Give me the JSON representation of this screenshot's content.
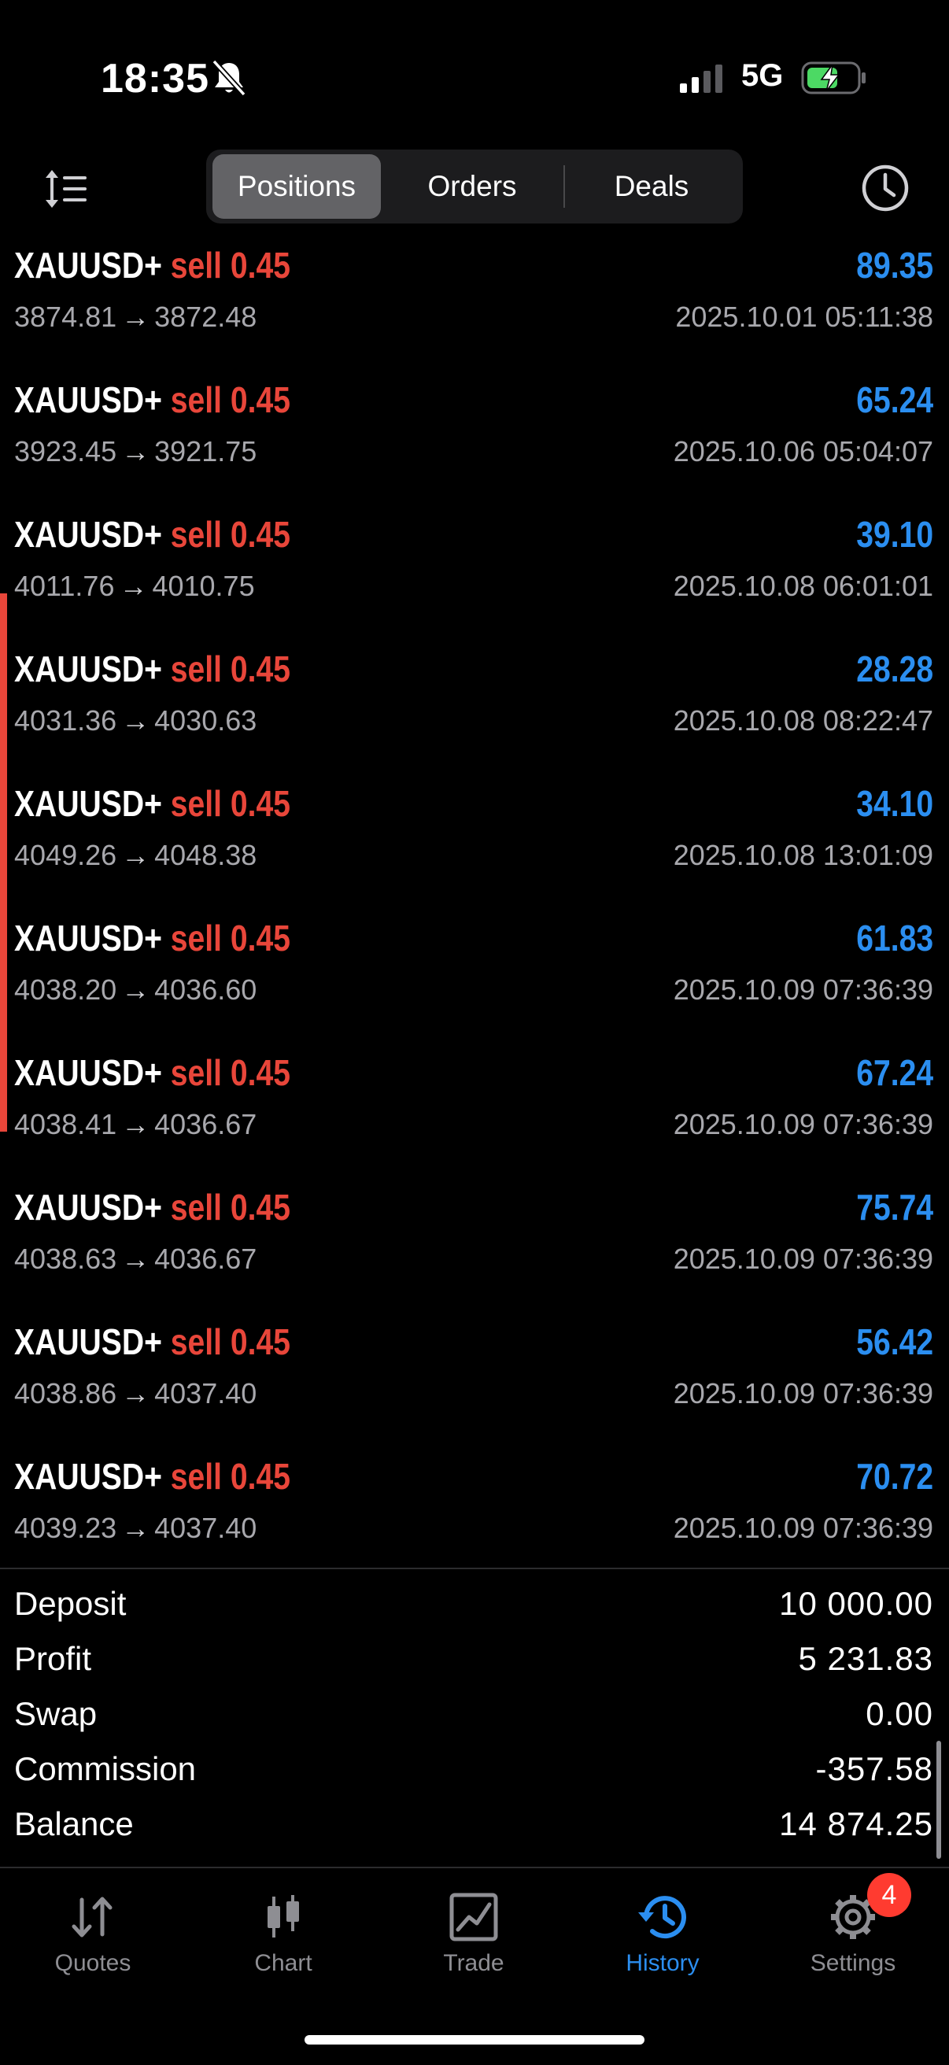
{
  "status": {
    "time": "18:35",
    "network": "5G"
  },
  "tabs": {
    "positions": "Positions",
    "orders": "Orders",
    "deals": "Deals"
  },
  "deals": [
    {
      "symbol": "XAUUSD+",
      "side": "sell",
      "volume": "0.45",
      "open_price": "3874.81",
      "close_price": "3872.48",
      "profit": "89.35",
      "time": "2025.10.01 05:11:38"
    },
    {
      "symbol": "XAUUSD+",
      "side": "sell",
      "volume": "0.45",
      "open_price": "3923.45",
      "close_price": "3921.75",
      "profit": "65.24",
      "time": "2025.10.06 05:04:07"
    },
    {
      "symbol": "XAUUSD+",
      "side": "sell",
      "volume": "0.45",
      "open_price": "4011.76",
      "close_price": "4010.75",
      "profit": "39.10",
      "time": "2025.10.08 06:01:01"
    },
    {
      "symbol": "XAUUSD+",
      "side": "sell",
      "volume": "0.45",
      "open_price": "4031.36",
      "close_price": "4030.63",
      "profit": "28.28",
      "time": "2025.10.08 08:22:47"
    },
    {
      "symbol": "XAUUSD+",
      "side": "sell",
      "volume": "0.45",
      "open_price": "4049.26",
      "close_price": "4048.38",
      "profit": "34.10",
      "time": "2025.10.08 13:01:09"
    },
    {
      "symbol": "XAUUSD+",
      "side": "sell",
      "volume": "0.45",
      "open_price": "4038.20",
      "close_price": "4036.60",
      "profit": "61.83",
      "time": "2025.10.09 07:36:39"
    },
    {
      "symbol": "XAUUSD+",
      "side": "sell",
      "volume": "0.45",
      "open_price": "4038.41",
      "close_price": "4036.67",
      "profit": "67.24",
      "time": "2025.10.09 07:36:39"
    },
    {
      "symbol": "XAUUSD+",
      "side": "sell",
      "volume": "0.45",
      "open_price": "4038.63",
      "close_price": "4036.67",
      "profit": "75.74",
      "time": "2025.10.09 07:36:39"
    },
    {
      "symbol": "XAUUSD+",
      "side": "sell",
      "volume": "0.45",
      "open_price": "4038.86",
      "close_price": "4037.40",
      "profit": "56.42",
      "time": "2025.10.09 07:36:39"
    },
    {
      "symbol": "XAUUSD+",
      "side": "sell",
      "volume": "0.45",
      "open_price": "4039.23",
      "close_price": "4037.40",
      "profit": "70.72",
      "time": "2025.10.09 07:36:39"
    }
  ],
  "summary": {
    "deposit_label": "Deposit",
    "deposit": "10 000.00",
    "profit_label": "Profit",
    "profit": "5 231.83",
    "swap_label": "Swap",
    "swap": "0.00",
    "commission_label": "Commission",
    "commission": "-357.58",
    "balance_label": "Balance",
    "balance": "14 874.25"
  },
  "tabbar": {
    "quotes": "Quotes",
    "chart": "Chart",
    "trade": "Trade",
    "history": "History",
    "settings": "Settings",
    "settings_badge": "4"
  },
  "colors": {
    "sell": "#e8463a",
    "profit": "#2b8ef0",
    "accent": "#2b8ef0",
    "badge": "#ff3b30"
  }
}
